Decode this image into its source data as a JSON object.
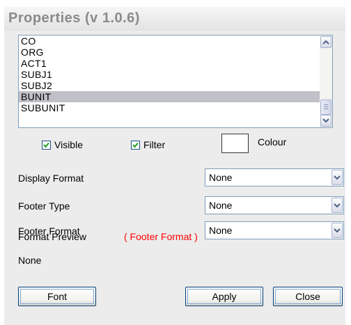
{
  "window": {
    "title": "Properties (v 1.0.6)"
  },
  "columns_list": {
    "items": [
      "CO",
      "ORG",
      "ACT1",
      "SUBJ1",
      "SUBJ2",
      "BUNIT",
      "SUBUNIT"
    ],
    "selected": "BUNIT"
  },
  "options": {
    "visible_label": "Visible",
    "visible_checked": true,
    "filter_label": "Filter",
    "filter_checked": true,
    "colour_label": "Colour",
    "colour_value": "#ffffff"
  },
  "display_format": {
    "label": "Display Format",
    "value": "None"
  },
  "footer_type": {
    "label": "Footer Type",
    "value": "None"
  },
  "footer_format": {
    "label": "Footer Format",
    "value": "None"
  },
  "format_preview": {
    "label": "Format Preview",
    "value": "( Footer Format )",
    "value_color": "#ff0000",
    "sample": "None"
  },
  "buttons": {
    "font": "Font",
    "apply": "Apply",
    "close": "Close"
  },
  "icons": {
    "scroll_up": "chevron-up-icon",
    "scroll_down": "chevron-down-icon",
    "check": "check-icon",
    "dropdown": "chevron-down-icon"
  }
}
